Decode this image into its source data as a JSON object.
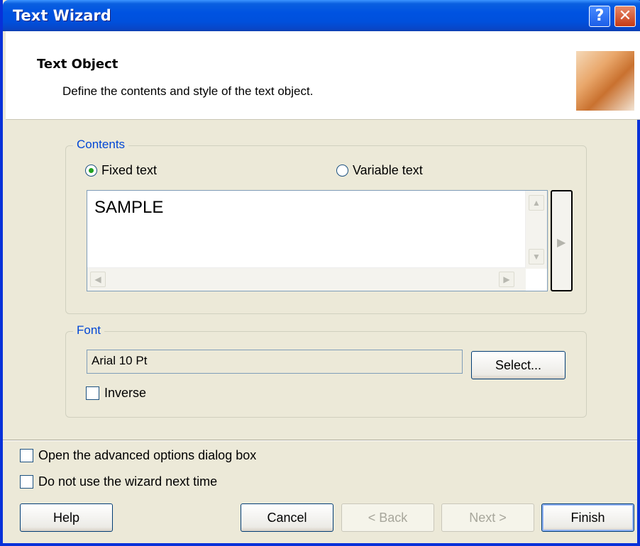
{
  "window": {
    "title": "Text Wizard"
  },
  "titlebar": {
    "help_label": "?",
    "close_label": "✕"
  },
  "header": {
    "title": "Text Object",
    "subtitle": "Define the contents and style of the text object."
  },
  "contents": {
    "group_label": "Contents",
    "fixed_text_label": "Fixed text",
    "fixed_text_selected": true,
    "variable_text_label": "Variable text",
    "text_value": "SAMPLE"
  },
  "font": {
    "group_label": "Font",
    "value": "Arial 10 Pt",
    "select_label": "Select...",
    "inverse_label": "Inverse",
    "inverse_checked": false
  },
  "options": {
    "advanced_label": "Open the advanced options dialog box",
    "no_wizard_label": "Do not use the wizard next time"
  },
  "buttons": {
    "help": "Help",
    "cancel": "Cancel",
    "back": "< Back",
    "next": "Next >",
    "finish": "Finish"
  },
  "scroll_glyphs": {
    "up": "▲",
    "down": "▼",
    "left": "◀",
    "right": "▶"
  }
}
